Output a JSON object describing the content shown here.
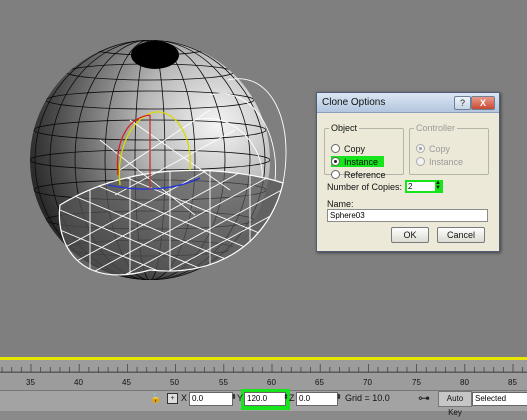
{
  "dialog": {
    "title": "Clone Options",
    "help": "?",
    "close": "X",
    "object": {
      "legend": "Object",
      "options": [
        {
          "label": "Copy",
          "selected": false
        },
        {
          "label": "Instance",
          "selected": true
        },
        {
          "label": "Reference",
          "selected": false
        }
      ]
    },
    "controller": {
      "legend": "Controller",
      "options": [
        {
          "label": "Copy",
          "selected": true
        },
        {
          "label": "Instance",
          "selected": false
        }
      ]
    },
    "copies_label": "Number of Copies:",
    "copies_value": "2",
    "name_label": "Name:",
    "name_value": "Sphere03",
    "ok": "OK",
    "cancel": "Cancel"
  },
  "timeline": {
    "ticks": [
      "35",
      "40",
      "45",
      "50",
      "55",
      "60",
      "65",
      "70",
      "75",
      "80",
      "85"
    ]
  },
  "status": {
    "lock_icon": "lock-icon",
    "x_label": "X",
    "x_value": "0.0",
    "y_label": "Y",
    "y_value": "120.0",
    "z_label": "Z",
    "z_value": "0.0",
    "grid": "Grid = 10.0",
    "auto_key": "Auto Key",
    "selected": "Selected"
  },
  "colors": {
    "highlight": "#17e51c",
    "timeline_marker": "#e6e600"
  }
}
